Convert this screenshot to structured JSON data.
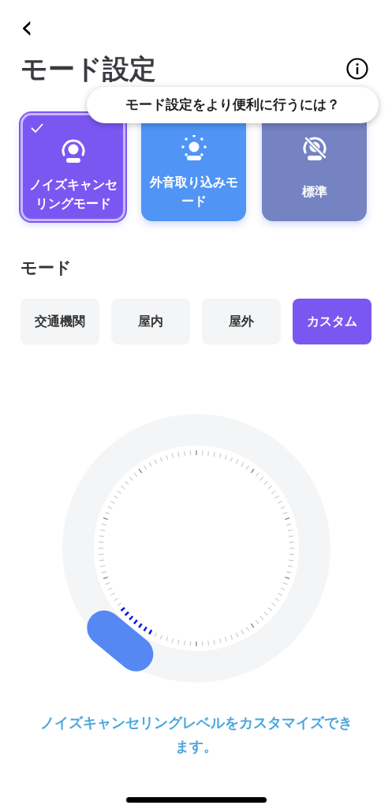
{
  "header": {
    "back": "‹",
    "title": "モード設定"
  },
  "tooltip": "モード設定をより便利に行うには？",
  "modes": [
    {
      "kind": "anc",
      "label": "ノイズキャンセリングモード",
      "selected": true
    },
    {
      "kind": "ambient",
      "label": "外音取り込みモード",
      "selected": false
    },
    {
      "kind": "off",
      "label": "標準",
      "selected": false
    }
  ],
  "submode": {
    "heading": "モード",
    "options": [
      {
        "label": "交通機関",
        "selected": false
      },
      {
        "label": "屋内",
        "selected": false
      },
      {
        "label": "屋外",
        "selected": false
      },
      {
        "label": "カスタム",
        "selected": true
      }
    ]
  },
  "caption": "ノイズキャンセリングレベルをカスタマイズできます。"
}
